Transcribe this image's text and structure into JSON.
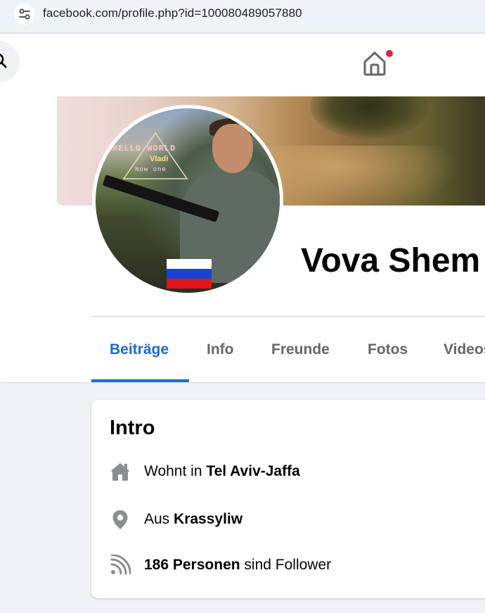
{
  "browser": {
    "url": "facebook.com/profile.php?id=100080489057880",
    "site_icon": "tune-icon"
  },
  "topnav": {
    "search_icon": "search-icon",
    "home_icon": "home-icon",
    "notification_color": "#e41e3f"
  },
  "profile": {
    "name": "Vova Shem",
    "avatar": {
      "overlay_line1": "HELLO WORLD",
      "overlay_line2": "Vladi",
      "overlay_line3": "Now one",
      "flag": "russian-flag"
    }
  },
  "tabs": [
    {
      "label": "Beiträge",
      "active": true
    },
    {
      "label": "Info",
      "active": false
    },
    {
      "label": "Freunde",
      "active": false
    },
    {
      "label": "Fotos",
      "active": false
    },
    {
      "label": "Videos",
      "active": false
    }
  ],
  "intro": {
    "title": "Intro",
    "lives": {
      "prefix": "Wohnt in ",
      "value": "Tel Aviv-Jaffa",
      "icon": "home-icon"
    },
    "from": {
      "prefix": "Aus ",
      "value": "Krassyliw",
      "icon": "location-pin-icon"
    },
    "followers": {
      "value": "186 Personen",
      "suffix": " sind Follower",
      "icon": "rss-icon"
    }
  },
  "colors": {
    "accent": "#1b6ad4",
    "page_bg": "#f0f2f5",
    "icon_gray": "#65676b"
  }
}
